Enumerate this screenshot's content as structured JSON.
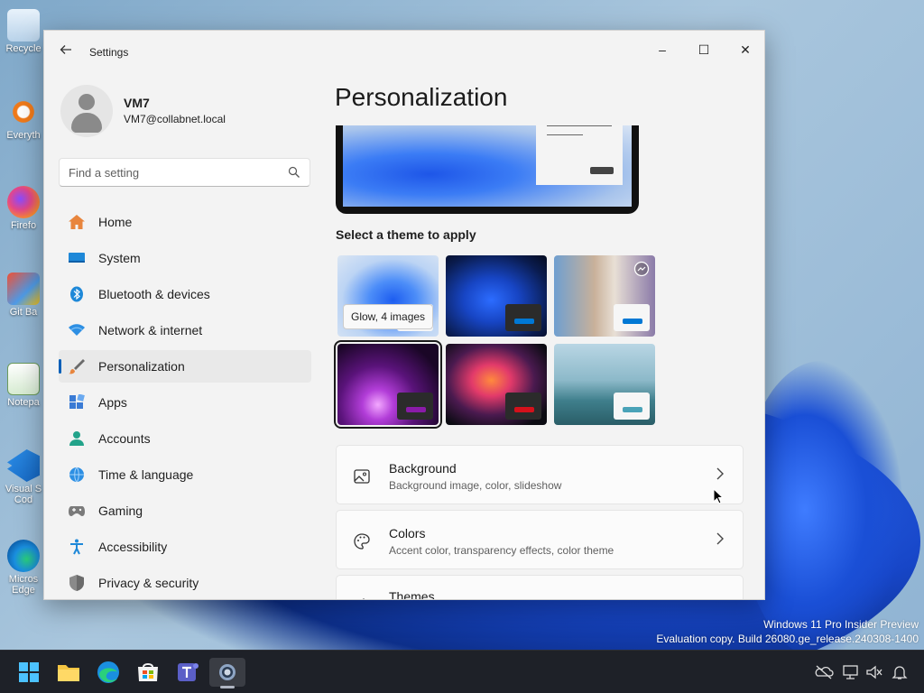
{
  "desktop": {
    "icons": [
      {
        "label": "Recycle",
        "icon": "recycle-bin-icon"
      },
      {
        "label": "Everyth",
        "icon": "everything-search-icon"
      },
      {
        "label": "Firefo",
        "icon": "firefox-icon"
      },
      {
        "label": "Git Ba",
        "icon": "git-bash-icon"
      },
      {
        "label": "Notepa",
        "icon": "notepad-icon"
      },
      {
        "label": "Visual S Cod",
        "icon": "vscode-icon"
      },
      {
        "label": "Micros Edge",
        "icon": "edge-icon"
      }
    ],
    "watermark_line1": "Windows 11 Pro Insider Preview",
    "watermark_line2": "Evaluation copy. Build 26080.ge_release.240308-1400"
  },
  "window": {
    "app_title": "Settings",
    "controls": {
      "minimize": "–",
      "maximize": "☐",
      "close": "✕"
    }
  },
  "user": {
    "name": "VM7",
    "email": "VM7@collabnet.local"
  },
  "search": {
    "placeholder": "Find a setting"
  },
  "nav": {
    "items": [
      {
        "label": "Home",
        "icon": "home-icon",
        "active": false
      },
      {
        "label": "System",
        "icon": "system-icon",
        "active": false
      },
      {
        "label": "Bluetooth & devices",
        "icon": "bluetooth-icon",
        "active": false
      },
      {
        "label": "Network & internet",
        "icon": "wifi-icon",
        "active": false
      },
      {
        "label": "Personalization",
        "icon": "brush-icon",
        "active": true
      },
      {
        "label": "Apps",
        "icon": "apps-icon",
        "active": false
      },
      {
        "label": "Accounts",
        "icon": "accounts-icon",
        "active": false
      },
      {
        "label": "Time & language",
        "icon": "globe-icon",
        "active": false
      },
      {
        "label": "Gaming",
        "icon": "gaming-icon",
        "active": false
      },
      {
        "label": "Accessibility",
        "icon": "accessibility-icon",
        "active": false
      },
      {
        "label": "Privacy & security",
        "icon": "shield-icon",
        "active": false
      }
    ]
  },
  "main": {
    "title": "Personalization",
    "themes_label": "Select a theme to apply",
    "tooltip": "Glow, 4 images",
    "themes": [
      {
        "name": "windows-light",
        "accent": "#0078d4"
      },
      {
        "name": "windows-dark",
        "accent": "#0078d4"
      },
      {
        "name": "spotlight",
        "accent": "#0078d4"
      },
      {
        "name": "glow",
        "accent": "#8a1ba8",
        "selected": true
      },
      {
        "name": "captured-motion",
        "accent": "#d4111b"
      },
      {
        "name": "flow",
        "accent": "#4aa3b8"
      }
    ],
    "cards": [
      {
        "title": "Background",
        "subtitle": "Background image, color, slideshow",
        "icon": "image-icon"
      },
      {
        "title": "Colors",
        "subtitle": "Accent color, transparency effects, color theme",
        "icon": "palette-icon"
      },
      {
        "title": "Themes",
        "subtitle": "",
        "icon": "themes-icon"
      }
    ]
  },
  "taskbar": {
    "apps": [
      "start-icon",
      "file-explorer-icon",
      "edge-icon",
      "store-icon",
      "teams-icon",
      "settings-icon"
    ],
    "tray": [
      "onedrive-icon",
      "network-icon",
      "volume-icon",
      "notifications-icon"
    ]
  },
  "colors": {
    "accent": "#005fb8"
  }
}
